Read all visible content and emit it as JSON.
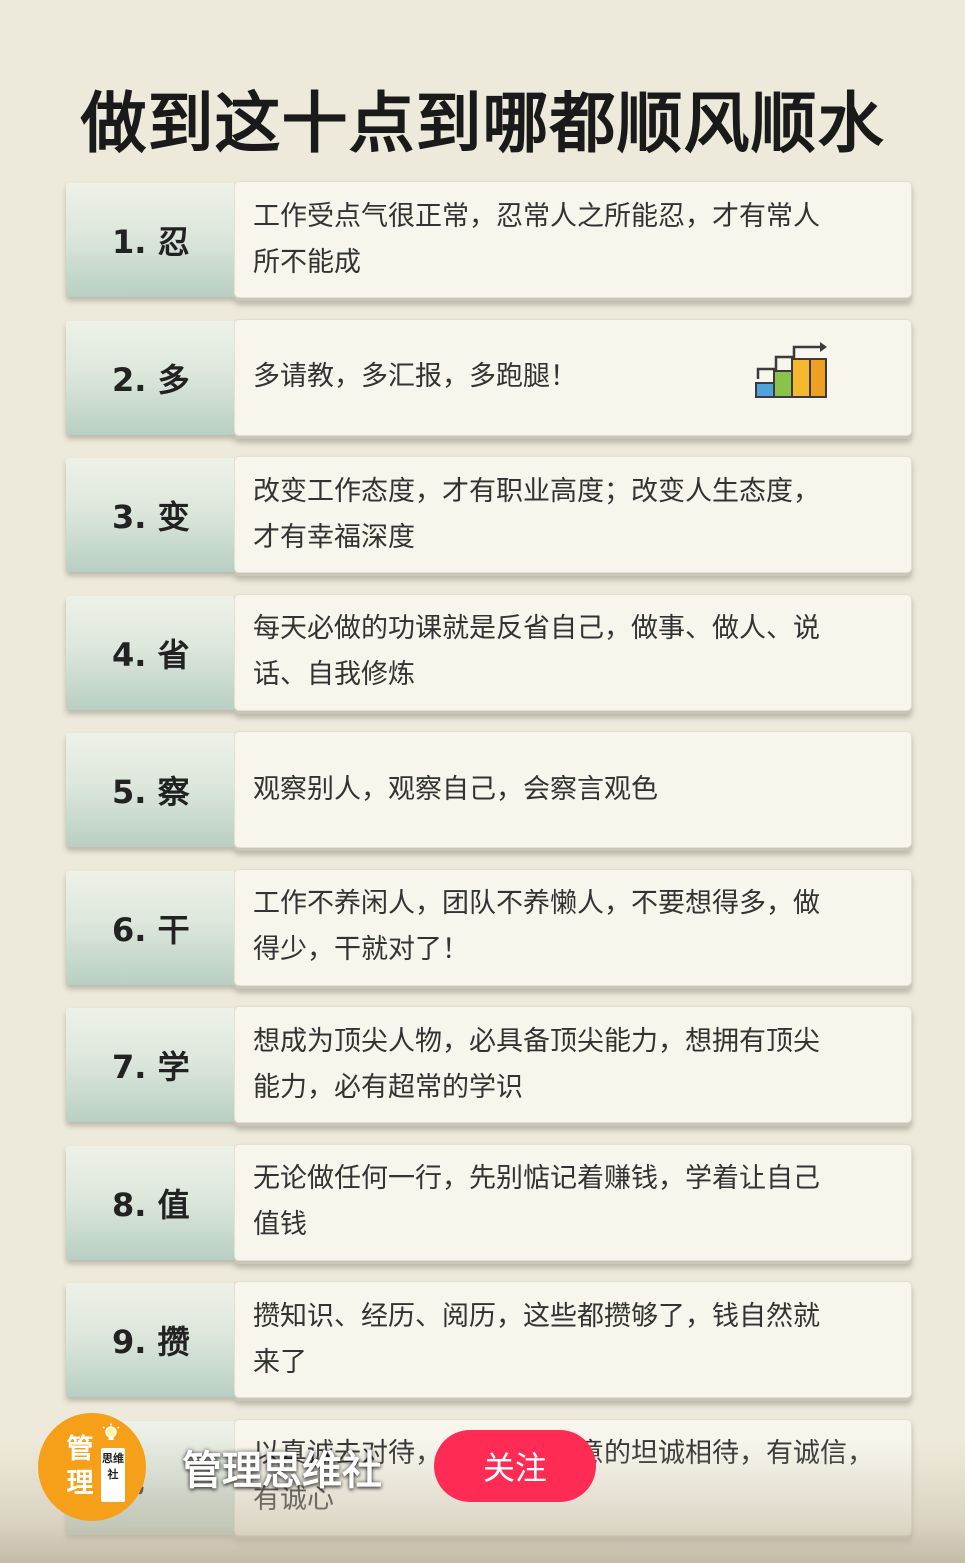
{
  "title": "做到这十点到哪都顺风顺水",
  "items": [
    {
      "label": "1. 忍",
      "lines": [
        "工作受点气很正常，忍常人之所能忍，才有常人",
        "所不能成"
      ]
    },
    {
      "label": "2. 多",
      "lines": [
        "多请教，多汇报，多跑腿！"
      ]
    },
    {
      "label": "3. 变",
      "lines": [
        "改变工作态度，才有职业高度；改变人生态度，",
        "才有幸福深度"
      ]
    },
    {
      "label": "4. 省",
      "lines": [
        "每天必做的功课就是反省自己，做事、做人、说",
        "话、自我修炼"
      ]
    },
    {
      "label": "5. 察",
      "lines": [
        "观察别人，观察自己，会察言观色"
      ]
    },
    {
      "label": "6. 干",
      "lines": [
        "工作不养闲人，团队不养懒人，不要想得多，做",
        "得少，干就对了！"
      ]
    },
    {
      "label": "7. 学",
      "lines": [
        "想成为顶尖人物，必具备顶尖能力，想拥有顶尖",
        "能力，必有超常的学识"
      ]
    },
    {
      "label": "8. 值",
      "lines": [
        "无论做任何一行，先别惦记着赚钱，学着让自己",
        "值钱"
      ]
    },
    {
      "label": "9. 攒",
      "lines": [
        "攒知识、经历、阅历，这些都攒够了，钱自然就",
        "来了"
      ]
    },
    {
      "label": "诚",
      "lines": [
        "以真诚去对待，做到真心实意的坦诚相待，有诚信，",
        "有诚心"
      ]
    }
  ],
  "account": {
    "name": "管理思维社",
    "avatar_big": "管理",
    "avatar_tag": "思维社",
    "follow_label": "关注"
  },
  "colors": {
    "follow_button": "#fe2c55",
    "avatar": "#f5a018",
    "background": "#eeeadb"
  },
  "icons": {
    "growth_chart": "bar-chart-growth-icon",
    "avatar_bulb": "lightbulb-icon"
  }
}
